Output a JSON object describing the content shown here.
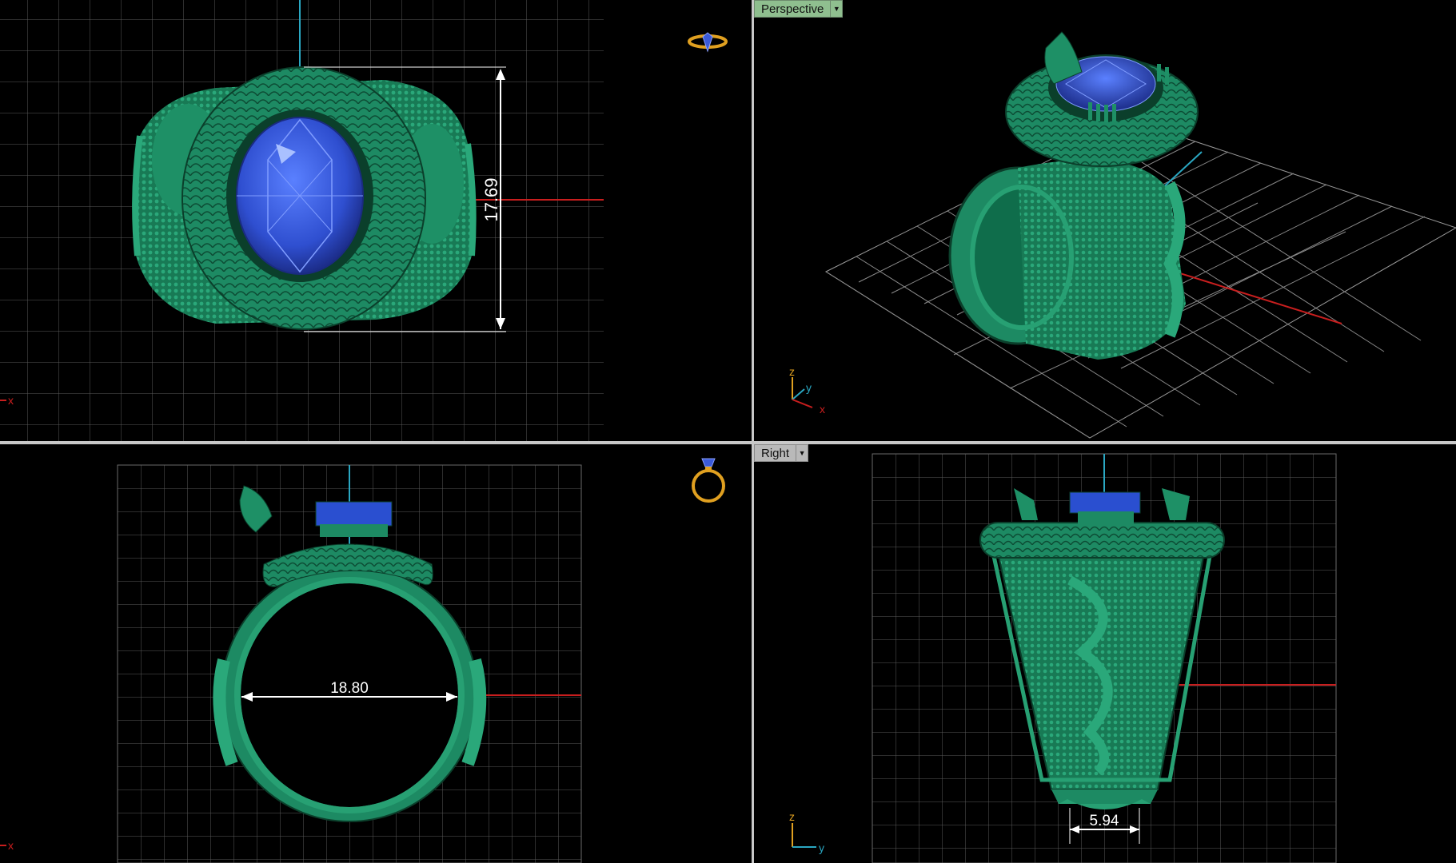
{
  "viewports": {
    "top": {
      "dimension": "17.69",
      "axis_x": "x"
    },
    "perspective": {
      "label": "Perspective",
      "axis_z": "z",
      "axis_y": "y",
      "axis_x": "x"
    },
    "front": {
      "dimension": "18.80",
      "axis_x": "x"
    },
    "right": {
      "label": "Right",
      "dimension": "5.94",
      "axis_z": "z",
      "axis_y": "y"
    }
  },
  "icons": [
    "ring-top-icon",
    "ring-front-icon",
    "dropdown-caret-icon",
    "axis-gizmo-icon"
  ],
  "colors": {
    "background": "#000000",
    "grid": "#5a5a5a",
    "model": "#1f8a66",
    "gem": "#2f55d4",
    "x_axis": "#c81e1e",
    "y_axis": "#2aa7c2",
    "z_axis": "#e0a020"
  }
}
